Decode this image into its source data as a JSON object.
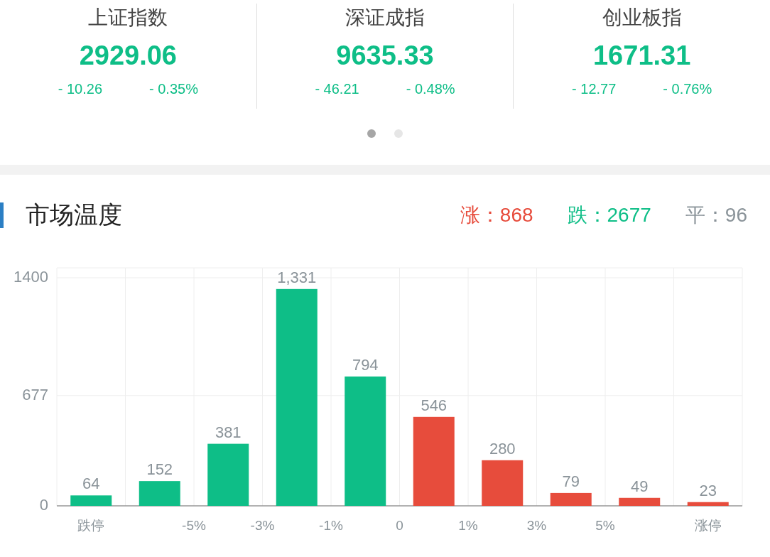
{
  "indices": [
    {
      "name": "上证指数",
      "value": "2929.06",
      "change": "- 10.26",
      "percent": "- 0.35%"
    },
    {
      "name": "深证成指",
      "value": "9635.33",
      "change": "- 46.21",
      "percent": "- 0.48%"
    },
    {
      "name": "创业板指",
      "value": "1671.31",
      "change": "- 12.77",
      "percent": "- 0.76%"
    }
  ],
  "pager": [
    {
      "selected": true
    },
    {
      "selected": false
    }
  ],
  "market_temperature": {
    "title": "市场温度",
    "stats": [
      {
        "text": "涨：868",
        "kind": "up"
      },
      {
        "text": "跌：2677",
        "kind": "down"
      },
      {
        "text": "平：96",
        "kind": "flat"
      }
    ],
    "chart_data": {
      "type": "bar",
      "categories": [
        "跌停",
        null,
        null,
        null,
        null,
        null,
        null,
        null,
        null,
        "涨停"
      ],
      "series": [
        {
          "color": "#0ebe87",
          "values": [
            64,
            152,
            381,
            1331,
            794,
            null,
            null,
            null,
            null,
            null
          ]
        },
        {
          "color": "#e74c3c",
          "values": [
            null,
            null,
            null,
            null,
            null,
            546,
            280,
            79,
            49,
            23
          ]
        }
      ],
      "ylim": [
        0,
        1461
      ],
      "yticks": [
        0,
        677,
        1400
      ],
      "value_labels": [
        "64",
        "152",
        "381",
        "1,331",
        "794",
        "546",
        "280",
        "79",
        "49",
        "23"
      ]
    },
    "boundary_labels": [
      "-5%",
      "-3%",
      "-1%",
      "0",
      "1%",
      "3%",
      "5%"
    ]
  }
}
